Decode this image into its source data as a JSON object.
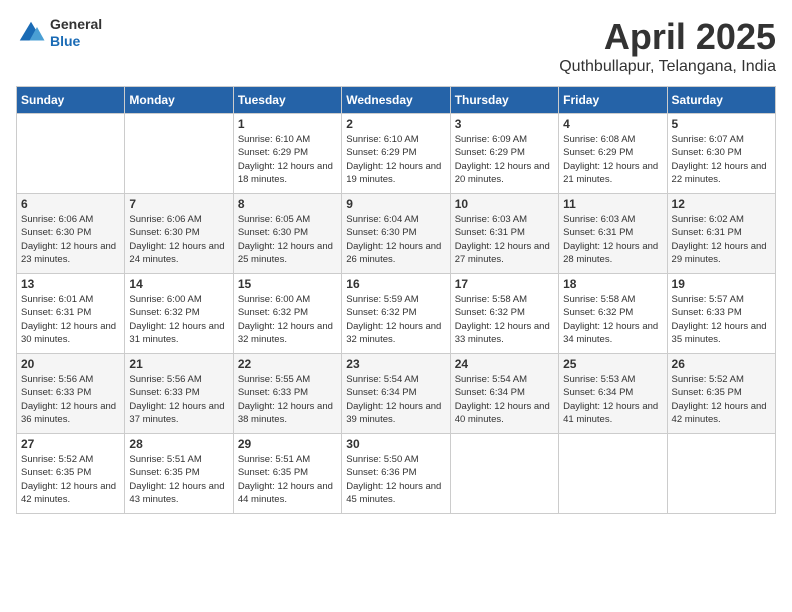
{
  "header": {
    "logo": {
      "general": "General",
      "blue": "Blue"
    },
    "title": "April 2025",
    "location": "Quthbullapur, Telangana, India"
  },
  "weekdays": [
    "Sunday",
    "Monday",
    "Tuesday",
    "Wednesday",
    "Thursday",
    "Friday",
    "Saturday"
  ],
  "weeks": [
    [
      null,
      null,
      {
        "day": 1,
        "sunrise": "Sunrise: 6:10 AM",
        "sunset": "Sunset: 6:29 PM",
        "daylight": "Daylight: 12 hours and 18 minutes."
      },
      {
        "day": 2,
        "sunrise": "Sunrise: 6:10 AM",
        "sunset": "Sunset: 6:29 PM",
        "daylight": "Daylight: 12 hours and 19 minutes."
      },
      {
        "day": 3,
        "sunrise": "Sunrise: 6:09 AM",
        "sunset": "Sunset: 6:29 PM",
        "daylight": "Daylight: 12 hours and 20 minutes."
      },
      {
        "day": 4,
        "sunrise": "Sunrise: 6:08 AM",
        "sunset": "Sunset: 6:29 PM",
        "daylight": "Daylight: 12 hours and 21 minutes."
      },
      {
        "day": 5,
        "sunrise": "Sunrise: 6:07 AM",
        "sunset": "Sunset: 6:30 PM",
        "daylight": "Daylight: 12 hours and 22 minutes."
      }
    ],
    [
      {
        "day": 6,
        "sunrise": "Sunrise: 6:06 AM",
        "sunset": "Sunset: 6:30 PM",
        "daylight": "Daylight: 12 hours and 23 minutes."
      },
      {
        "day": 7,
        "sunrise": "Sunrise: 6:06 AM",
        "sunset": "Sunset: 6:30 PM",
        "daylight": "Daylight: 12 hours and 24 minutes."
      },
      {
        "day": 8,
        "sunrise": "Sunrise: 6:05 AM",
        "sunset": "Sunset: 6:30 PM",
        "daylight": "Daylight: 12 hours and 25 minutes."
      },
      {
        "day": 9,
        "sunrise": "Sunrise: 6:04 AM",
        "sunset": "Sunset: 6:30 PM",
        "daylight": "Daylight: 12 hours and 26 minutes."
      },
      {
        "day": 10,
        "sunrise": "Sunrise: 6:03 AM",
        "sunset": "Sunset: 6:31 PM",
        "daylight": "Daylight: 12 hours and 27 minutes."
      },
      {
        "day": 11,
        "sunrise": "Sunrise: 6:03 AM",
        "sunset": "Sunset: 6:31 PM",
        "daylight": "Daylight: 12 hours and 28 minutes."
      },
      {
        "day": 12,
        "sunrise": "Sunrise: 6:02 AM",
        "sunset": "Sunset: 6:31 PM",
        "daylight": "Daylight: 12 hours and 29 minutes."
      }
    ],
    [
      {
        "day": 13,
        "sunrise": "Sunrise: 6:01 AM",
        "sunset": "Sunset: 6:31 PM",
        "daylight": "Daylight: 12 hours and 30 minutes."
      },
      {
        "day": 14,
        "sunrise": "Sunrise: 6:00 AM",
        "sunset": "Sunset: 6:32 PM",
        "daylight": "Daylight: 12 hours and 31 minutes."
      },
      {
        "day": 15,
        "sunrise": "Sunrise: 6:00 AM",
        "sunset": "Sunset: 6:32 PM",
        "daylight": "Daylight: 12 hours and 32 minutes."
      },
      {
        "day": 16,
        "sunrise": "Sunrise: 5:59 AM",
        "sunset": "Sunset: 6:32 PM",
        "daylight": "Daylight: 12 hours and 32 minutes."
      },
      {
        "day": 17,
        "sunrise": "Sunrise: 5:58 AM",
        "sunset": "Sunset: 6:32 PM",
        "daylight": "Daylight: 12 hours and 33 minutes."
      },
      {
        "day": 18,
        "sunrise": "Sunrise: 5:58 AM",
        "sunset": "Sunset: 6:32 PM",
        "daylight": "Daylight: 12 hours and 34 minutes."
      },
      {
        "day": 19,
        "sunrise": "Sunrise: 5:57 AM",
        "sunset": "Sunset: 6:33 PM",
        "daylight": "Daylight: 12 hours and 35 minutes."
      }
    ],
    [
      {
        "day": 20,
        "sunrise": "Sunrise: 5:56 AM",
        "sunset": "Sunset: 6:33 PM",
        "daylight": "Daylight: 12 hours and 36 minutes."
      },
      {
        "day": 21,
        "sunrise": "Sunrise: 5:56 AM",
        "sunset": "Sunset: 6:33 PM",
        "daylight": "Daylight: 12 hours and 37 minutes."
      },
      {
        "day": 22,
        "sunrise": "Sunrise: 5:55 AM",
        "sunset": "Sunset: 6:33 PM",
        "daylight": "Daylight: 12 hours and 38 minutes."
      },
      {
        "day": 23,
        "sunrise": "Sunrise: 5:54 AM",
        "sunset": "Sunset: 6:34 PM",
        "daylight": "Daylight: 12 hours and 39 minutes."
      },
      {
        "day": 24,
        "sunrise": "Sunrise: 5:54 AM",
        "sunset": "Sunset: 6:34 PM",
        "daylight": "Daylight: 12 hours and 40 minutes."
      },
      {
        "day": 25,
        "sunrise": "Sunrise: 5:53 AM",
        "sunset": "Sunset: 6:34 PM",
        "daylight": "Daylight: 12 hours and 41 minutes."
      },
      {
        "day": 26,
        "sunrise": "Sunrise: 5:52 AM",
        "sunset": "Sunset: 6:35 PM",
        "daylight": "Daylight: 12 hours and 42 minutes."
      }
    ],
    [
      {
        "day": 27,
        "sunrise": "Sunrise: 5:52 AM",
        "sunset": "Sunset: 6:35 PM",
        "daylight": "Daylight: 12 hours and 42 minutes."
      },
      {
        "day": 28,
        "sunrise": "Sunrise: 5:51 AM",
        "sunset": "Sunset: 6:35 PM",
        "daylight": "Daylight: 12 hours and 43 minutes."
      },
      {
        "day": 29,
        "sunrise": "Sunrise: 5:51 AM",
        "sunset": "Sunset: 6:35 PM",
        "daylight": "Daylight: 12 hours and 44 minutes."
      },
      {
        "day": 30,
        "sunrise": "Sunrise: 5:50 AM",
        "sunset": "Sunset: 6:36 PM",
        "daylight": "Daylight: 12 hours and 45 minutes."
      },
      null,
      null,
      null
    ]
  ]
}
